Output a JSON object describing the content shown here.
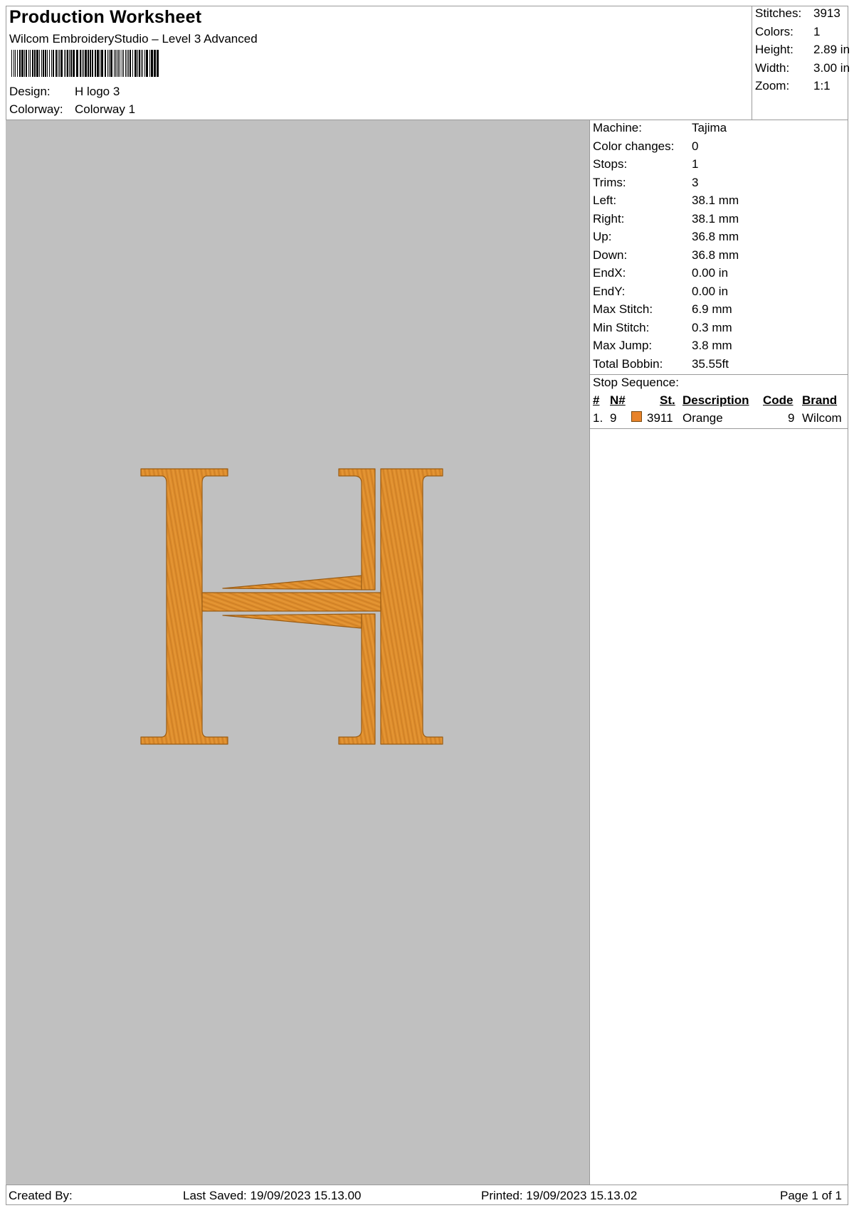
{
  "header": {
    "title": "Production Worksheet",
    "software": "Wilcom EmbroideryStudio – Level 3 Advanced",
    "design_label": "Design:",
    "design_value": "H logo 3",
    "colorway_label": "Colorway:",
    "colorway_value": "Colorway 1"
  },
  "summary": [
    {
      "label": "Stitches:",
      "value": "3913"
    },
    {
      "label": "Colors:",
      "value": "1"
    },
    {
      "label": "Height:",
      "value": "2.89 in"
    },
    {
      "label": "Width:",
      "value": "3.00 in"
    },
    {
      "label": "Zoom:",
      "value": "1:1"
    }
  ],
  "details": [
    {
      "label": "Machine:",
      "value": "Tajima"
    },
    {
      "label": "Color changes:",
      "value": "0"
    },
    {
      "label": "Stops:",
      "value": "1"
    },
    {
      "label": "Trims:",
      "value": "3"
    },
    {
      "label": "Left:",
      "value": "38.1 mm"
    },
    {
      "label": "Right:",
      "value": "38.1 mm"
    },
    {
      "label": "Up:",
      "value": "36.8 mm"
    },
    {
      "label": "Down:",
      "value": "36.8 mm"
    },
    {
      "label": "EndX:",
      "value": "0.00 in"
    },
    {
      "label": "EndY:",
      "value": "0.00 in"
    },
    {
      "label": "Max Stitch:",
      "value": "6.9 mm"
    },
    {
      "label": "Min Stitch:",
      "value": "0.3 mm"
    },
    {
      "label": "Max Jump:",
      "value": "3.8 mm"
    },
    {
      "label": "Total Bobbin:",
      "value": "35.55ft"
    }
  ],
  "stop_sequence": {
    "title": "Stop Sequence:",
    "columns": [
      "#",
      "N#",
      "St.",
      "Description",
      "Code",
      "Brand"
    ],
    "rows": [
      {
        "index": "1.",
        "needle": "9",
        "swatch_color": "#e8832a",
        "stitches": "3911",
        "description": "Orange",
        "code": "9",
        "brand": "Wilcom"
      }
    ]
  },
  "design": {
    "thread_color": "#e2902e",
    "background_color": "#c0c0c0"
  },
  "footer": {
    "created_by": "Created By:",
    "last_saved": "Last Saved: 19/09/2023 15.13.00",
    "printed": "Printed: 19/09/2023 15.13.02",
    "page": "Page 1 of 1"
  }
}
